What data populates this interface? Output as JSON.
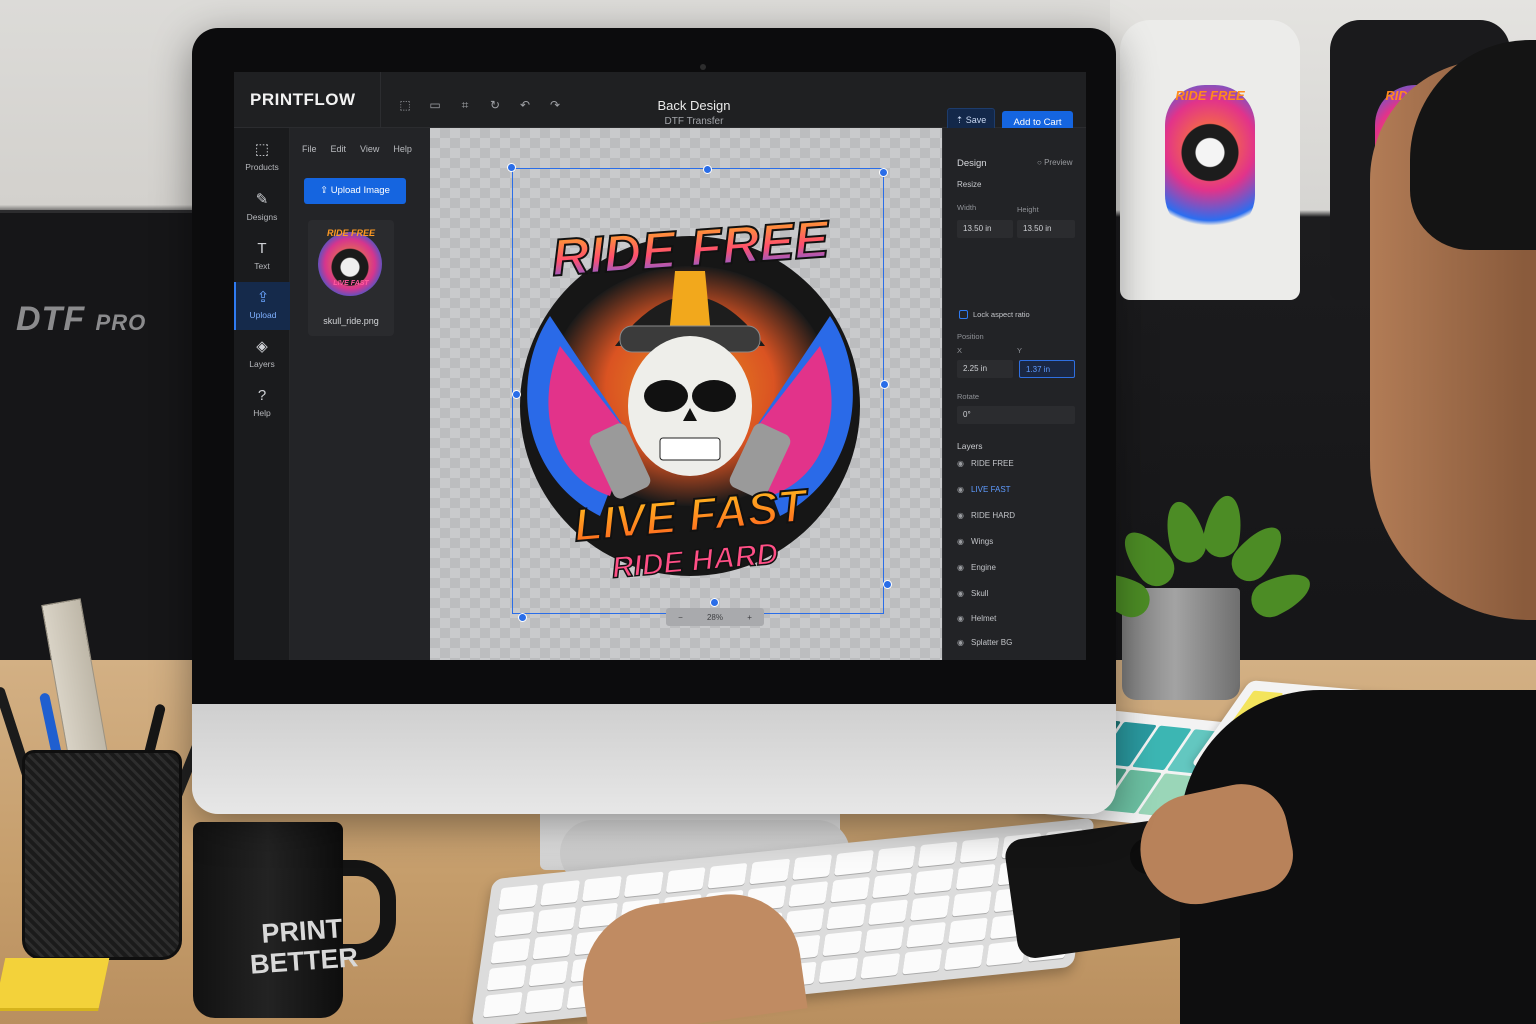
{
  "environment": {
    "shelf_label": "DTF",
    "shelf_label_sub": "PRO",
    "mug_line1": "PRINT",
    "mug_line2": "BETTER",
    "tshirt_print_top": "RIDE FREE",
    "tshirt_print_bottom": "RIDE FREE"
  },
  "app": {
    "logo": "PRINTFLOW",
    "doc_title": "Back Design",
    "doc_subtitle": "DTF Transfer",
    "save_label": "Save",
    "add_to_cart_label": "Add to Cart",
    "toolbar_icons": [
      "select-icon",
      "folder-icon",
      "crop-icon",
      "rotate-icon",
      "undo-icon",
      "redo-icon"
    ]
  },
  "rail": {
    "items": [
      {
        "label": "Products",
        "icon": "box-icon"
      },
      {
        "label": "Designs",
        "icon": "edit-icon"
      },
      {
        "label": "Text",
        "icon": "text-icon"
      },
      {
        "label": "Upload",
        "icon": "upload-icon"
      },
      {
        "label": "Layers",
        "icon": "layers-icon"
      },
      {
        "label": "Help",
        "icon": "help-icon"
      }
    ],
    "active": "Upload"
  },
  "panel": {
    "menu": [
      "File",
      "Edit",
      "View",
      "Help"
    ],
    "upload_label": "Upload Image",
    "thumb_name": "skull_ride.png",
    "thumb_top": "RIDE FREE",
    "thumb_bottom": "LIVE FAST"
  },
  "canvas": {
    "art_top": "RIDE FREE",
    "art_mid": "LIVE FAST",
    "art_bottom": "RIDE HARD",
    "zoom": "28%"
  },
  "inspector": {
    "tab": "Design",
    "preview": "Preview",
    "section": "Resize",
    "width_label": "Width",
    "height_label": "Height",
    "width_value": "13.50 in",
    "height_value": "13.50 in",
    "lock_label": "Lock aspect ratio",
    "position_label": "Position",
    "x_label": "X",
    "y_label": "Y",
    "x_value": "2.25 in",
    "y_value": "1.37 in",
    "rotate_label": "Rotate",
    "rotate_value": "0°",
    "layers_title": "Layers",
    "layers": [
      "RIDE FREE",
      "LIVE FAST",
      "RIDE HARD",
      "Wings",
      "Engine",
      "Skull",
      "Helmet",
      "Splatter BG"
    ],
    "selected_layer": "LIVE FAST"
  },
  "colors": {
    "accent": "#1565e0",
    "selection": "#2a6de8",
    "art_orange": "#ff8a1e",
    "art_pink": "#e2338a",
    "art_blue": "#2b6ef0"
  }
}
